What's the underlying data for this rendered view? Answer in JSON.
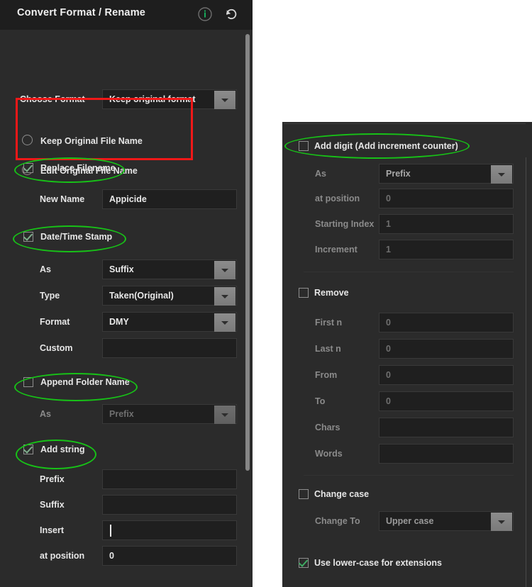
{
  "window": {
    "title": "Convert Format / Rename",
    "icons": {
      "info": "info-icon",
      "reset": "reset-icon"
    }
  },
  "colors": {
    "panel_bg": "#2b2b2b",
    "header_bg": "#1e1e1e",
    "field_bg": "#1f1f1f",
    "accent_green": "#15b560",
    "annotation_green": "#17c217",
    "annotation_red": "#f01818",
    "text": "#e6e6e6",
    "text_dim": "#8b8b8b"
  },
  "left_panel": {
    "choose_format": {
      "label": "Choose Format",
      "value": "Keep original format"
    },
    "name_mode": {
      "options": [
        {
          "label": "Keep Original File Name",
          "selected": false
        },
        {
          "label": "Edit Original File Name",
          "selected": true
        }
      ]
    },
    "replace_filename": {
      "label": "Replace Filename",
      "checked": true,
      "fields": [
        {
          "label": "New Name",
          "value": "Appicide"
        }
      ]
    },
    "datetime_stamp": {
      "label": "Date/Time Stamp",
      "checked": true,
      "fields": [
        {
          "label": "As",
          "value": "Suffix",
          "type": "dropdown"
        },
        {
          "label": "Type",
          "value": "Taken(Original)",
          "type": "dropdown"
        },
        {
          "label": "Format",
          "value": "DMY",
          "type": "dropdown"
        },
        {
          "label": "Custom",
          "value": "",
          "type": "text"
        }
      ]
    },
    "append_folder_name": {
      "label": "Append Folder Name",
      "checked": false,
      "fields": [
        {
          "label": "As",
          "value": "Prefix",
          "type": "dropdown"
        }
      ]
    },
    "add_string": {
      "label": "Add string",
      "checked": true,
      "fields": [
        {
          "label": "Prefix",
          "value": "",
          "type": "text"
        },
        {
          "label": "Suffix",
          "value": "",
          "type": "text"
        },
        {
          "label": "Insert",
          "value": "",
          "type": "text-focused"
        },
        {
          "label": "at position",
          "value": "0",
          "type": "text"
        }
      ]
    }
  },
  "right_panel": {
    "add_digit": {
      "label": "Add digit (Add increment counter)",
      "checked": false,
      "fields": [
        {
          "label": "As",
          "value": "Prefix",
          "type": "dropdown"
        },
        {
          "label": "at position",
          "value": "0",
          "type": "text"
        },
        {
          "label": "Starting Index",
          "value": "1",
          "type": "text"
        },
        {
          "label": "Increment",
          "value": "1",
          "type": "text"
        }
      ]
    },
    "remove": {
      "label": "Remove",
      "checked": false,
      "fields": [
        {
          "label": "First n",
          "value": "0",
          "type": "text"
        },
        {
          "label": "Last n",
          "value": "0",
          "type": "text"
        },
        {
          "label": "From",
          "value": "0",
          "type": "text"
        },
        {
          "label": "To",
          "value": "0",
          "type": "text"
        },
        {
          "label": "Chars",
          "value": "",
          "type": "text"
        },
        {
          "label": "Words",
          "value": "",
          "type": "text"
        }
      ]
    },
    "change_case": {
      "label": "Change case",
      "checked": false,
      "fields": [
        {
          "label": "Change To",
          "value": "Upper case",
          "type": "dropdown"
        }
      ]
    },
    "use_lowercase_ext": {
      "label": "Use lower-case for extensions",
      "checked": true
    }
  }
}
